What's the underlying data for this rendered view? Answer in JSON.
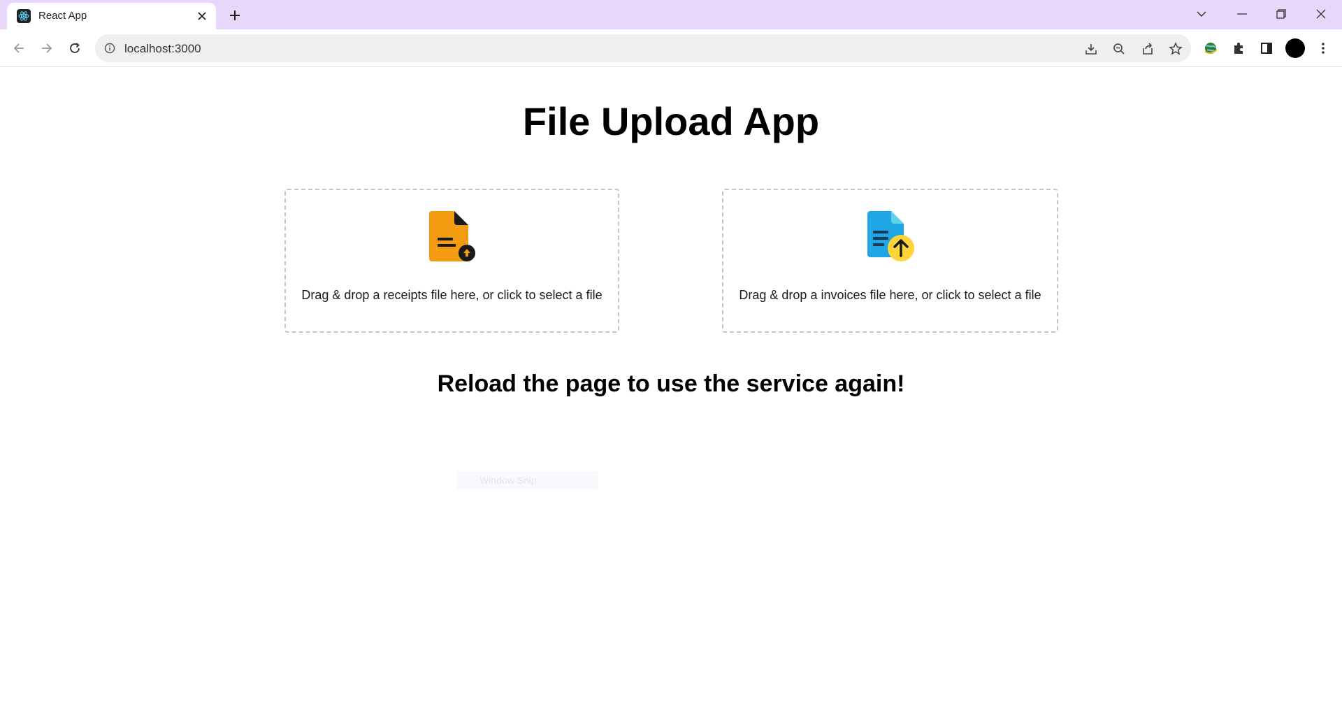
{
  "browser": {
    "tab_title": "React App",
    "url": "localhost:3000"
  },
  "app": {
    "title": "File Upload App",
    "dropzones": [
      {
        "label": "Drag & drop a receipts file here, or click to select a file",
        "icon": "receipt-upload-icon",
        "accent": "#f39c12"
      },
      {
        "label": "Drag & drop a invoices file here, or click to select a file",
        "icon": "invoice-upload-icon",
        "accent": "#1ea7e4"
      }
    ],
    "message": "Reload the page to use the service again!",
    "ghost_text": "Window Snip"
  },
  "colors": {
    "tabbar": "#e7d8fb",
    "dropzone_border": "#c5c5c5"
  }
}
